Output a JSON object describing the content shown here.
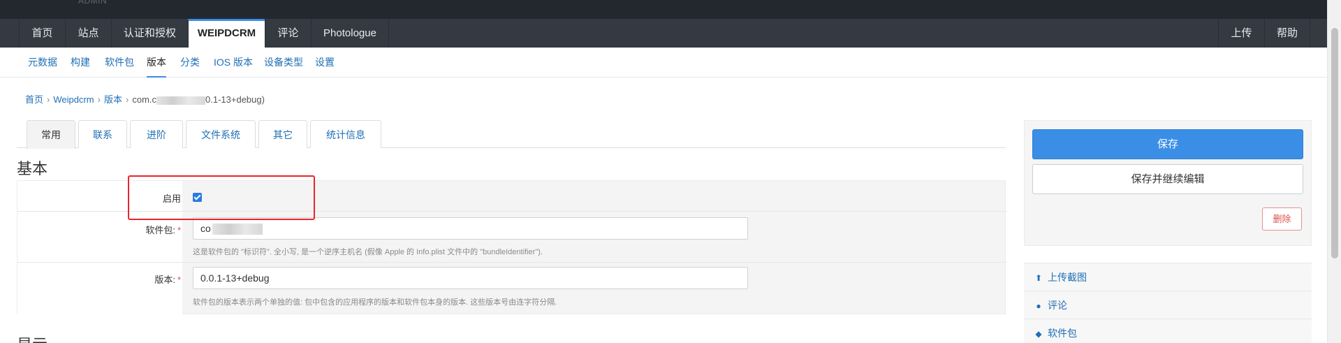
{
  "header": {
    "admin_label": "ADMIN"
  },
  "nav": {
    "items": [
      {
        "label": "首页"
      },
      {
        "label": "站点"
      },
      {
        "label": "认证和授权"
      },
      {
        "label": "WEIPDCRM"
      },
      {
        "label": "评论"
      },
      {
        "label": "Photologue"
      }
    ],
    "right": [
      {
        "label": "上传"
      },
      {
        "label": "帮助"
      }
    ]
  },
  "subnav": {
    "items": [
      {
        "label": "元数据"
      },
      {
        "label": "构建"
      },
      {
        "label": "软件包"
      },
      {
        "label": "版本"
      },
      {
        "label": "分类"
      },
      {
        "label": "IOS 版本"
      },
      {
        "label": "设备类型"
      },
      {
        "label": "设置"
      }
    ]
  },
  "breadcrumb": {
    "home": "首页",
    "app": "Weipdcrm",
    "model": "版本",
    "current_prefix": "com.c",
    "current_suffix": "0.1-13+debug)"
  },
  "tabs": [
    {
      "label": "常用"
    },
    {
      "label": "联系"
    },
    {
      "label": "进阶"
    },
    {
      "label": "文件系统"
    },
    {
      "label": "其它"
    },
    {
      "label": "统计信息"
    }
  ],
  "sections": {
    "basic": "基本",
    "next": "显示"
  },
  "form": {
    "enabled": {
      "label": "启用",
      "checked": true
    },
    "package": {
      "label": "软件包:",
      "required": "*",
      "value_prefix": "co",
      "help": "这是软件包的 \"标识符\". 全小写, 是一个逆序主机名 (假像 Apple 的 Info.plist 文件中的 \"bundleIdentifier\")."
    },
    "version": {
      "label": "版本:",
      "required": "*",
      "value": "0.0.1-13+debug",
      "help": "软件包的版本表示两个单独的值: 包中包含的应用程序的版本和软件包本身的版本. 这些版本号由连字符分隔."
    }
  },
  "actions": {
    "save": "保存",
    "save_continue": "保存并继续编辑",
    "delete": "删除"
  },
  "side_links": [
    {
      "label": "上传截图",
      "icon": "upload-icon"
    },
    {
      "label": "评论",
      "icon": "comments-icon"
    },
    {
      "label": "软件包",
      "icon": "cube-icon"
    }
  ],
  "colors": {
    "accent": "#3a8ee6",
    "navbar": "#343a42",
    "topbar": "#23282f",
    "highlight": "#e8262b",
    "danger": "#d9534f"
  }
}
